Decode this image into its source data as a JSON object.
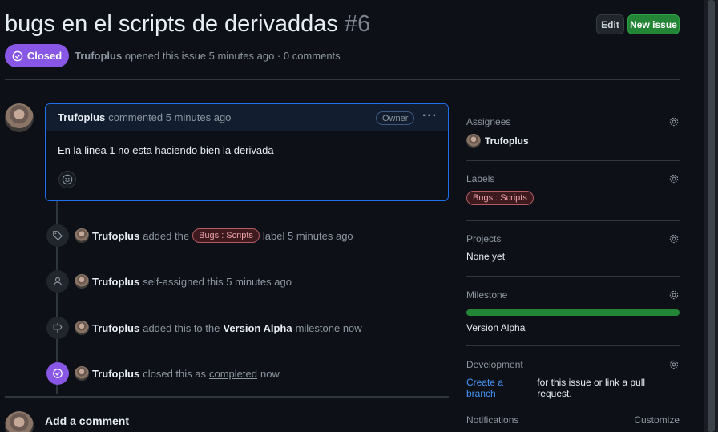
{
  "issue": {
    "title": "bugs en el scripts de derivaddas",
    "number": "#6",
    "state": "Closed",
    "author": "Trufoplus",
    "meta_text": "opened this issue 5 minutes ago · 0 comments"
  },
  "header_buttons": {
    "edit": "Edit",
    "new_issue": "New issue"
  },
  "comment": {
    "author": "Trufoplus",
    "time": "commented 5 minutes ago",
    "role": "Owner",
    "body": "En la linea 1 no esta haciendo bien la derivada"
  },
  "timeline": [
    {
      "actor": "Trufoplus",
      "pre": "added the",
      "label": "Bugs : Scripts",
      "post": "label 5 minutes ago"
    },
    {
      "actor": "Trufoplus",
      "pre": "self-assigned this 5 minutes ago"
    },
    {
      "actor": "Trufoplus",
      "pre": "added this to the",
      "strong": "Version Alpha",
      "post": "milestone now"
    },
    {
      "actor": "Trufoplus",
      "pre": "closed this as",
      "underline": "completed",
      "post": "now"
    }
  ],
  "add_comment": "Add a comment",
  "sidebar": {
    "assignees": {
      "heading": "Assignees",
      "value": "Trufoplus"
    },
    "labels": {
      "heading": "Labels",
      "value": "Bugs : Scripts"
    },
    "projects": {
      "heading": "Projects",
      "value": "None yet"
    },
    "milestone": {
      "heading": "Milestone",
      "value": "Version Alpha",
      "progress": 1.0
    },
    "development": {
      "heading": "Development",
      "link": "Create a branch",
      "rest": "for this issue or link a pull request."
    },
    "notifications": {
      "heading": "Notifications",
      "action": "Customize"
    }
  },
  "colors": {
    "closed": "#8957e5",
    "new_issue": "#238636",
    "label_border": "#b45a63",
    "link": "#4493f8",
    "focus_border": "#1f6feb"
  },
  "icons": [
    "check-circle-icon",
    "kebab-horizontal-icon",
    "smiley-icon",
    "tag-icon",
    "person-icon",
    "milestone-icon",
    "gear-icon"
  ]
}
